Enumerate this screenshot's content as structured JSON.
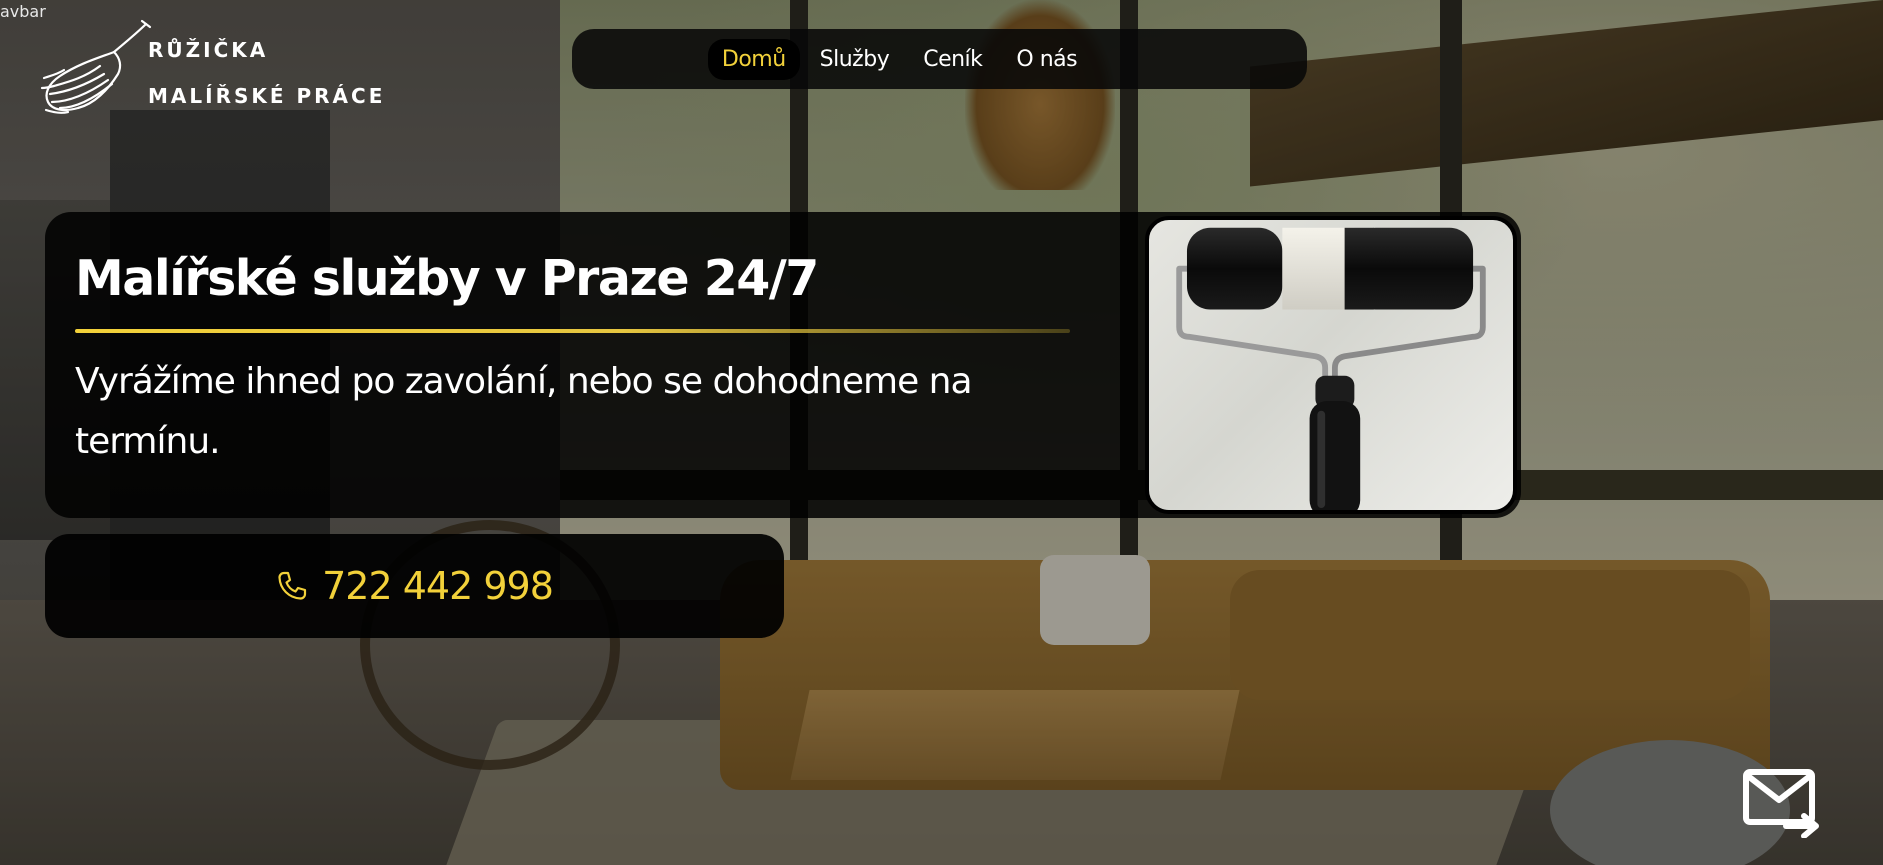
{
  "top_fragment": "avbar",
  "brand": {
    "name": "RŮŽIČKA",
    "tagline": "MALÍŘSKÉ PRÁCE",
    "logo_icon": "paintbrush-icon"
  },
  "nav": {
    "items": [
      {
        "label": "Domů",
        "active": true
      },
      {
        "label": "Služby",
        "active": false
      },
      {
        "label": "Ceník",
        "active": false
      },
      {
        "label": "O nás",
        "active": false
      }
    ]
  },
  "hero": {
    "title": "Malířské služby v Praze 24/7",
    "subtitle": "Vyrážíme ihned po zavolání, nebo se dohodneme na termínu.",
    "photo_icon": "paint-roller-icon"
  },
  "contact": {
    "phone": "722 442 998",
    "phone_icon": "phone-icon",
    "mail_icon": "mail-send-icon"
  },
  "colors": {
    "accent": "#f2d13a",
    "panel": "#000000",
    "text": "#ffffff"
  }
}
